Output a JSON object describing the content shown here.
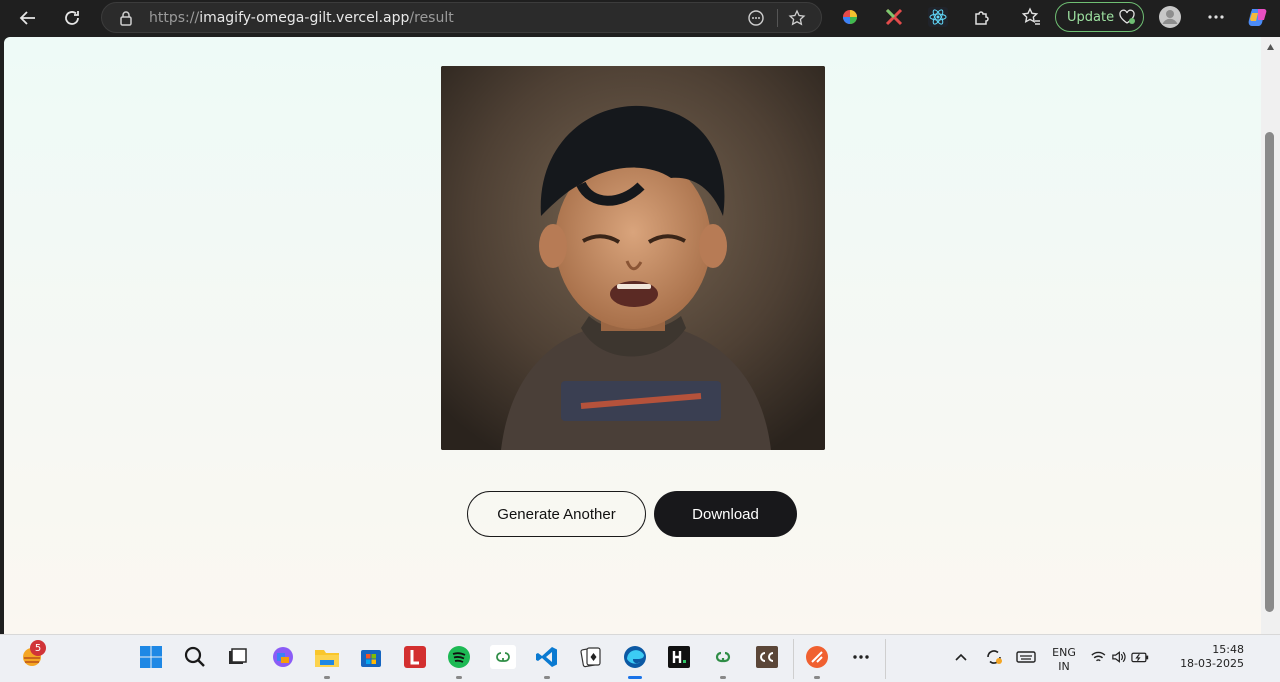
{
  "browser": {
    "url_prefix": "https://",
    "url_host": "imagify-omega-gilt.vercel.app",
    "url_path": "/result",
    "update_label": "Update"
  },
  "page": {
    "image_alt": "Generated image",
    "generate_another_label": "Generate Another",
    "download_label": "Download"
  },
  "taskbar": {
    "weather_badge": "5",
    "language_top": "ENG",
    "language_bottom": "IN",
    "time": "15:48",
    "date": "18-03-2025"
  }
}
